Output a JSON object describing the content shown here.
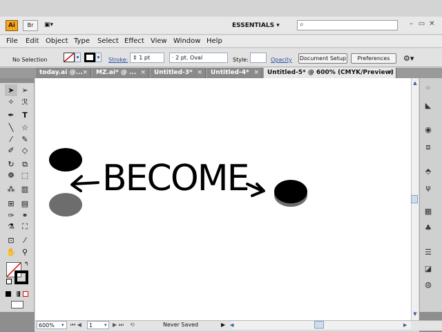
{
  "app": {
    "logo": "Ai",
    "bridge_label": "Br",
    "workspace": "ESSENTIALS"
  },
  "search": {
    "placeholder": ""
  },
  "window_controls": {
    "minimize": "–",
    "restore": "▭",
    "close": "✕"
  },
  "menu": [
    "File",
    "Edit",
    "Object",
    "Type",
    "Select",
    "Effect",
    "View",
    "Window",
    "Help"
  ],
  "control_bar": {
    "selection": "No Selection",
    "stroke_label": "Stroke:",
    "stroke_weight": "1 pt",
    "brush": "2 pt. Oval",
    "style_label": "Style:",
    "opacity_label": "Opacity",
    "document_setup": "Document Setup",
    "preferences": "Preferences"
  },
  "tabs": [
    {
      "label": "today.ai @...",
      "close": "×"
    },
    {
      "label": "MZ.ai* @ ...",
      "close": "×"
    },
    {
      "label": "Untitled-3*",
      "close": "×"
    },
    {
      "label": "Untitled-4*",
      "close": "×"
    },
    {
      "label": "Untitled-5* @ 600% (CMYK/Preview)",
      "close": "×"
    }
  ],
  "artwork": {
    "text": "BECOME",
    "colors": {
      "black": "#000000",
      "gray": "#6d6d6d"
    }
  },
  "status": {
    "zoom": "600%",
    "artboard": "1",
    "save_state": "Never Saved"
  },
  "icons": {
    "tools": [
      "selection-tool-icon",
      "direct-selection-tool-icon",
      "magic-wand-icon",
      "lasso-icon",
      "pen-tool-icon",
      "type-tool-icon",
      "line-tool-icon",
      "star-tool-icon",
      "paintbrush-icon",
      "pencil-icon",
      "blob-brush-icon",
      "eraser-icon",
      "rotate-tool-icon",
      "scale-tool-icon",
      "warp-tool-icon",
      "free-transform-icon",
      "symbol-sprayer-icon",
      "column-graph-icon",
      "mesh-tool-icon",
      "gradient-tool-icon",
      "eyedropper-icon",
      "blend-tool-icon",
      "live-paint-icon",
      "live-paint-select-icon",
      "artboard-tool-icon",
      "slice-tool-icon",
      "hand-tool-icon",
      "zoom-tool-icon"
    ]
  }
}
